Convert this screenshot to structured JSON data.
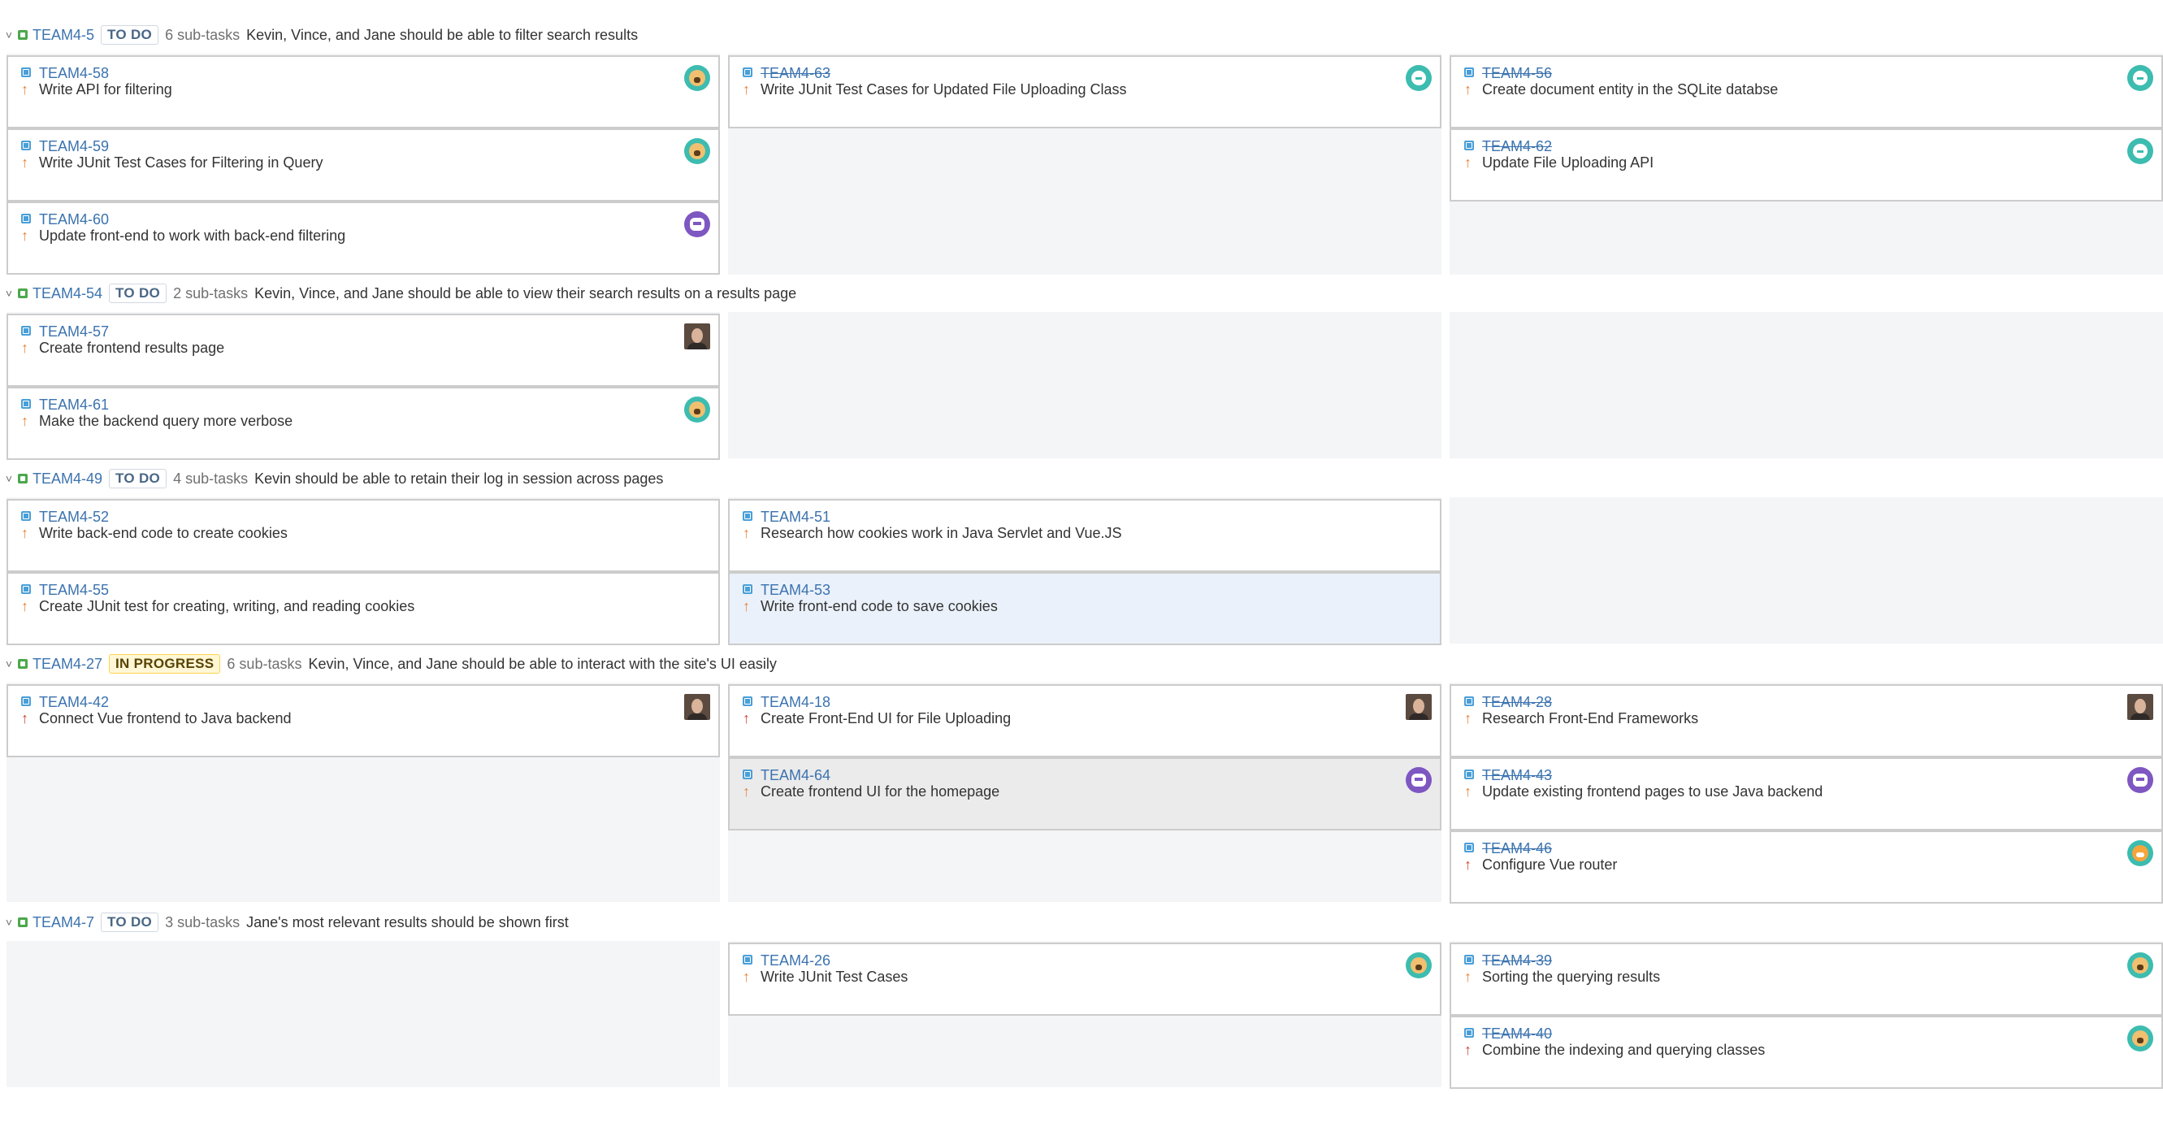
{
  "swimlanes": [
    {
      "key": "TEAM4-5",
      "status": "TO DO",
      "subtasks": "6 sub-tasks",
      "summary": "Kevin, Vince, and Jane should be able to filter search results"
    },
    {
      "key": "TEAM4-54",
      "status": "TO DO",
      "subtasks": "2 sub-tasks",
      "summary": "Kevin, Vince, and Jane should be able to view their search results on a results page"
    },
    {
      "key": "TEAM4-49",
      "status": "TO DO",
      "subtasks": "4 sub-tasks",
      "summary": "Kevin should be able to retain their log in session across pages"
    },
    {
      "key": "TEAM4-27",
      "status": "IN PROGRESS",
      "subtasks": "6 sub-tasks",
      "summary": "Kevin, Vince, and Jane should be able to interact with the site's UI easily"
    },
    {
      "key": "TEAM4-7",
      "status": "TO DO",
      "subtasks": "3 sub-tasks",
      "summary": "Jane's most relevant results should be shown first"
    }
  ],
  "cards": [
    {
      "key": "TEAM4-58",
      "summary": "Write API for filtering",
      "priority": "major",
      "done": false,
      "avatar": "dog-avatar"
    },
    {
      "key": "TEAM4-59",
      "summary": "Write JUnit Test Cases for Filtering in Query",
      "priority": "major",
      "done": false,
      "avatar": "dog-avatar"
    },
    {
      "key": "TEAM4-60",
      "summary": "Update front-end to work with back-end filtering",
      "priority": "major",
      "done": false,
      "avatar": "robot-avatar"
    },
    {
      "key": "TEAM4-63",
      "summary": "Write JUnit Test Cases for Updated File Uploading Class",
      "priority": "major",
      "done": true,
      "avatar": "ghost-avatar"
    },
    {
      "key": "TEAM4-56",
      "summary": "Create document entity in the SQLite databse",
      "priority": "major",
      "done": true,
      "avatar": "ghost-avatar"
    },
    {
      "key": "TEAM4-62",
      "summary": "Update File Uploading API",
      "priority": "major",
      "done": true,
      "avatar": "ghost-avatar"
    },
    {
      "key": "TEAM4-57",
      "summary": "Create frontend results page",
      "priority": "major",
      "done": false,
      "avatar": "photo-avatar"
    },
    {
      "key": "TEAM4-61",
      "summary": "Make the backend query more verbose",
      "priority": "major",
      "done": false,
      "avatar": "dog-avatar"
    },
    {
      "key": "TEAM4-52",
      "summary": "Write back-end code to create cookies",
      "priority": "major",
      "done": false,
      "avatar": ""
    },
    {
      "key": "TEAM4-55",
      "summary": "Create JUnit test for creating, writing, and reading cookies",
      "priority": "major",
      "done": false,
      "avatar": ""
    },
    {
      "key": "TEAM4-51",
      "summary": "Research how cookies work in Java Servlet and Vue.JS",
      "priority": "major",
      "done": false,
      "avatar": ""
    },
    {
      "key": "TEAM4-53",
      "summary": "Write front-end code to save cookies",
      "priority": "major",
      "done": false,
      "avatar": ""
    },
    {
      "key": "TEAM4-42",
      "summary": "Connect Vue frontend to Java backend",
      "priority": "critical",
      "done": false,
      "avatar": "photo-avatar"
    },
    {
      "key": "TEAM4-18",
      "summary": "Create Front-End UI for File Uploading",
      "priority": "critical",
      "done": false,
      "avatar": "photo-avatar"
    },
    {
      "key": "TEAM4-64",
      "summary": "Create frontend UI for the homepage",
      "priority": "major",
      "done": false,
      "avatar": "robot-avatar"
    },
    {
      "key": "TEAM4-28",
      "summary": "Research Front-End Frameworks",
      "priority": "major",
      "done": true,
      "avatar": "photo-avatar"
    },
    {
      "key": "TEAM4-43",
      "summary": "Update existing frontend pages to use Java backend",
      "priority": "major",
      "done": true,
      "avatar": "robot-avatar"
    },
    {
      "key": "TEAM4-46",
      "summary": "Configure Vue router",
      "priority": "critical",
      "done": true,
      "avatar": "tiger-avatar"
    },
    {
      "key": "TEAM4-26",
      "summary": "Write JUnit Test Cases",
      "priority": "major",
      "done": false,
      "avatar": "dog-avatar"
    },
    {
      "key": "TEAM4-39",
      "summary": "Sorting the querying results",
      "priority": "major",
      "done": true,
      "avatar": "dog-avatar"
    },
    {
      "key": "TEAM4-40",
      "summary": "Combine the indexing and querying classes",
      "priority": "critical",
      "done": true,
      "avatar": "dog-avatar"
    }
  ],
  "icons": {
    "priority_arrow": "↑",
    "collapse_chevron": "˅"
  },
  "colors": {
    "link": "#3b73af",
    "priority_major": "#e8833a",
    "priority_critical": "#d04437",
    "story_green": "#4ca84c",
    "subtask_blue": "#4a9fd8"
  }
}
